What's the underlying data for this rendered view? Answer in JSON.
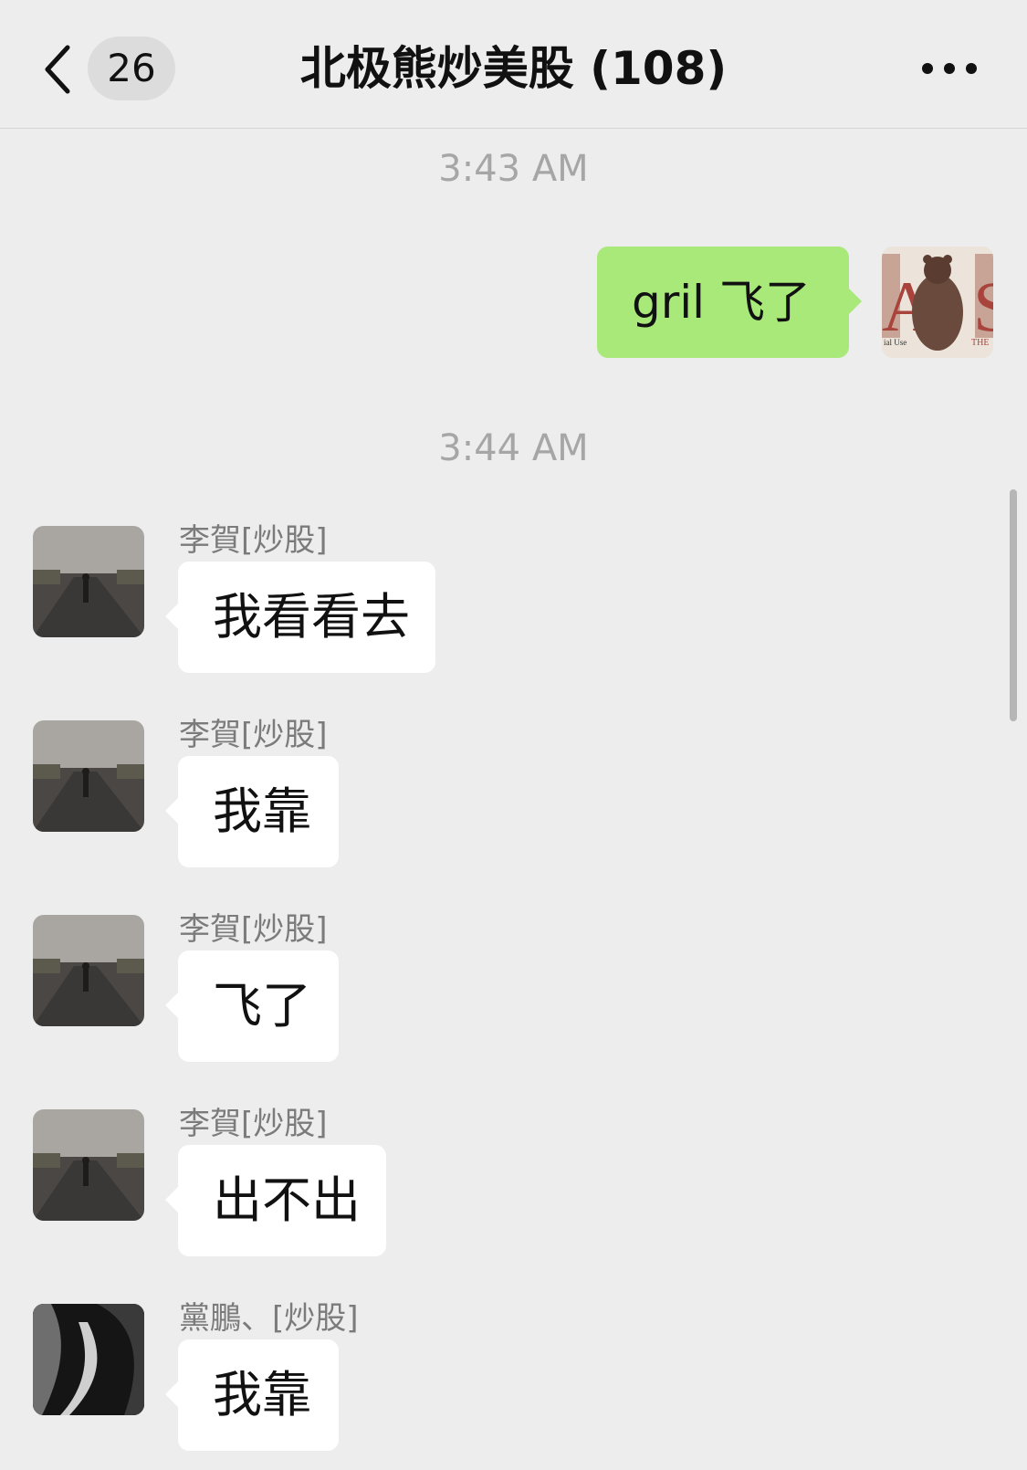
{
  "header": {
    "unread_count": "26",
    "title": "北极熊炒美股 (108)"
  },
  "messages": {
    "ts1": "3:43 AM",
    "ts2": "3:44 AM",
    "m1": {
      "text": "gril 飞了"
    },
    "m2": {
      "sender": "李賀[炒股]",
      "text": "我看看去"
    },
    "m3": {
      "sender": "李賀[炒股]",
      "text": "我靠"
    },
    "m4": {
      "sender": "李賀[炒股]",
      "text": "飞了"
    },
    "m5": {
      "sender": "李賀[炒股]",
      "text": "出不出"
    },
    "m6": {
      "sender": "黨鵬、[炒股]",
      "text": "我靠"
    }
  },
  "self_avatar_text": {
    "left": "A",
    "right": "S",
    "bottom_left": "ial Use",
    "bottom_right": "THE"
  },
  "colors": {
    "background": "#ededed",
    "bubble_self": "#a9e97a",
    "bubble_other": "#ffffff",
    "timestamp": "#a6a6a6",
    "sender": "#7b7b7b"
  },
  "icons": [
    "back-chevron-icon",
    "more-options-icon"
  ]
}
